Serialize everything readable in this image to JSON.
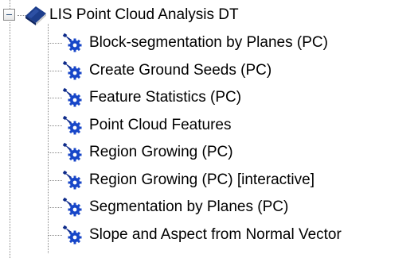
{
  "tree": {
    "root": {
      "label": "LIS Point Cloud Analysis DT",
      "icon": "book-icon",
      "expanded": true
    },
    "items": [
      {
        "label": "Block-segmentation by Planes (PC)",
        "icon": "tool-gear-icon"
      },
      {
        "label": "Create Ground Seeds (PC)",
        "icon": "tool-gear-icon"
      },
      {
        "label": "Feature Statistics (PC)",
        "icon": "tool-gear-icon"
      },
      {
        "label": "Point Cloud Features",
        "icon": "tool-gear-icon"
      },
      {
        "label": "Region Growing (PC)",
        "icon": "tool-gear-icon"
      },
      {
        "label": "Region Growing (PC) [interactive]",
        "icon": "tool-gear-icon"
      },
      {
        "label": "Segmentation by Planes (PC)",
        "icon": "tool-gear-icon"
      },
      {
        "label": "Slope and Aspect from Normal Vector",
        "icon": "tool-gear-icon"
      }
    ]
  },
  "colors": {
    "book_blue": "#1d3e8c",
    "tool_blue": "#1746c8",
    "connector": "#8a8a8a"
  }
}
